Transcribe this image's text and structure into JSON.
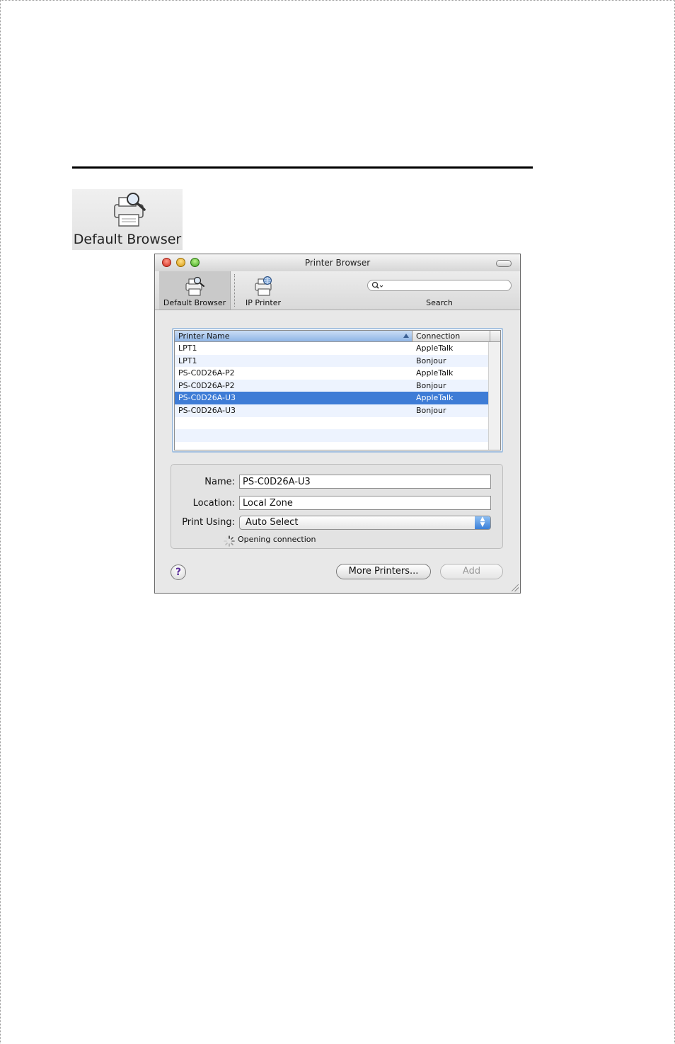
{
  "top_icon": {
    "label": "Default Browser",
    "icon": "printer-magnifier-icon"
  },
  "window": {
    "title": "Printer Browser",
    "toolbar": {
      "default_browser_label": "Default Browser",
      "ip_printer_label": "IP Printer",
      "search_label": "Search",
      "search_value": ""
    },
    "list": {
      "columns": [
        "Printer Name",
        "Connection"
      ],
      "sort": "ascending",
      "selected_index": 4,
      "rows": [
        {
          "name": "LPT1",
          "connection": "AppleTalk"
        },
        {
          "name": "LPT1",
          "connection": "Bonjour"
        },
        {
          "name": "PS-C0D26A-P2",
          "connection": "AppleTalk"
        },
        {
          "name": "PS-C0D26A-P2",
          "connection": "Bonjour"
        },
        {
          "name": "PS-C0D26A-U3",
          "connection": "AppleTalk"
        },
        {
          "name": "PS-C0D26A-U3",
          "connection": "Bonjour"
        }
      ]
    },
    "info": {
      "name_label": "Name:",
      "name_value": "PS-C0D26A-U3",
      "location_label": "Location:",
      "location_value": "Local Zone",
      "print_using_label": "Print Using:",
      "print_using_value": "Auto Select",
      "status_text": "Opening connection"
    },
    "buttons": {
      "help": "?",
      "more_printers": "More Printers...",
      "add": "Add"
    },
    "colors": {
      "selection": "#3e7cd6",
      "header_sorted": "#8fb5e6",
      "row_alt": "#edf3fe"
    }
  }
}
